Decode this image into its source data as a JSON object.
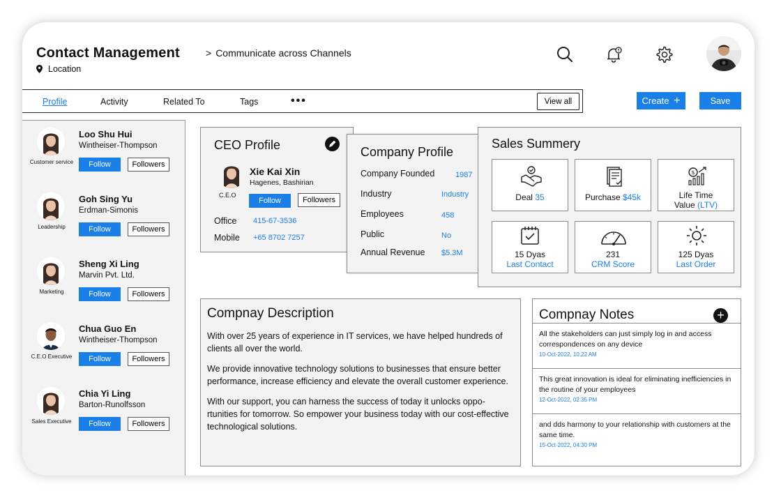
{
  "header": {
    "title": "Contact Management",
    "breadcrumb": "Communicate across Channels",
    "location": "Location"
  },
  "tabs": [
    "Profile",
    "Activity",
    "Related To",
    "Tags"
  ],
  "toolbar": {
    "more": "•••",
    "view_all": "View all",
    "create": "Create",
    "save": "Save"
  },
  "contacts": [
    {
      "name": "Loo Shu Hui",
      "company": "Wintheiser-Thompson",
      "role": "Customer service",
      "follow": "Follow",
      "followers": "Followers"
    },
    {
      "name": "Goh Sing Yu",
      "company": "Erdman-Simonis",
      "role": "Leadership",
      "follow": "Follow",
      "followers": "Followers"
    },
    {
      "name": "Sheng Xi Ling",
      "company": "Marvin Pvt. Ltd.",
      "role": "Marketing",
      "follow": "Follow",
      "followers": "Followers"
    },
    {
      "name": "Chua Guo En",
      "company": "Wintheiser-Thompson",
      "role": "C.E.O Executive",
      "follow": "Follow",
      "followers": "Followers"
    },
    {
      "name": "Chia Yi Ling",
      "company": "Barton-Runolfsson",
      "role": "Sales Executive",
      "follow": "Follow",
      "followers": "Followers"
    }
  ],
  "ceo": {
    "title": "CEO Profile",
    "name": "Xie Kai Xin",
    "location": "Hagenes, Bashirian",
    "role": "C.E.O",
    "follow": "Follow",
    "followers": "Followers",
    "office_label": "Office",
    "office": "415-67-3536",
    "mobile_label": "Mobile",
    "mobile": "+65 8702 7257"
  },
  "company": {
    "title": "Company Profile",
    "rows": [
      {
        "k": "Company Founded",
        "v": "1987"
      },
      {
        "k": "Industry",
        "v": "Industry"
      },
      {
        "k": "Employees",
        "v": "458"
      },
      {
        "k": "Public",
        "v": "No"
      },
      {
        "k": "Annual Revenue",
        "v": "$5.3M"
      }
    ]
  },
  "sales": {
    "title": "Sales Summery",
    "deal_label": "Deal",
    "deal_value": "35",
    "purchase_label": "Purchase",
    "purchase_value": "$45k",
    "ltv_label": "Life Time",
    "ltv_label2": "Value",
    "ltv_value": "(LTV)",
    "last_contact_value": "15 Dyas",
    "last_contact_label": "Last Contact",
    "crm_value": "231",
    "crm_label": "CRM Score",
    "last_order_value": "125 Dyas",
    "last_order_label": "Last Order"
  },
  "description": {
    "title": "Compnay Description",
    "p1": "With over 25 years of experience in IT services, we have helped hundreds of clients all over the world.",
    "p2": "We provide innovative technology solutions to businesses that ensure better performance, increase efficiency and elevate the overall customer experience.",
    "p3": "With our support, you can harness the success of today it unlocks oppo-rtunities for tomorrow. So empower your business today with our cost-effective technological solutions."
  },
  "notes": {
    "title": "Compnay Notes",
    "items": [
      {
        "text": "All the stakeholders can just simply log in and access correspondences on any device",
        "date": "10-Oct-2022, 10:22 AM"
      },
      {
        "text": "This great innovation is ideal for eliminating inefficiencies in the routine of your employees",
        "date": "12-Oct-2022, 02:35 PM"
      },
      {
        "text": "and dds harmony to your relationship with customers at the same time.",
        "date": "15-Oct-2022, 04:30 PM"
      }
    ]
  },
  "colors": {
    "accent": "#1a7fe6",
    "panel": "#f3f3f3",
    "border": "#8a8a8a"
  }
}
